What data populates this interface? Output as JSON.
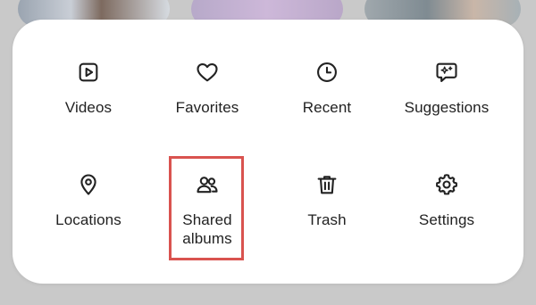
{
  "menu": {
    "items": [
      {
        "id": "videos",
        "label": "Videos",
        "icon": "video-play-icon"
      },
      {
        "id": "favorites",
        "label": "Favorites",
        "icon": "heart-icon"
      },
      {
        "id": "recent",
        "label": "Recent",
        "icon": "clock-icon"
      },
      {
        "id": "suggestions",
        "label": "Suggestions",
        "icon": "sparkle-chat-icon"
      },
      {
        "id": "locations",
        "label": "Locations",
        "icon": "location-pin-icon"
      },
      {
        "id": "shared_albums",
        "label": "Shared albums",
        "icon": "people-icon",
        "highlighted": true
      },
      {
        "id": "trash",
        "label": "Trash",
        "icon": "trash-icon"
      },
      {
        "id": "settings",
        "label": "Settings",
        "icon": "gear-icon"
      }
    ]
  },
  "colors": {
    "panel_background": "#ffffff",
    "page_background": "#c9c9c9",
    "icon_text": "#222222",
    "highlight_border": "#d9534f"
  }
}
